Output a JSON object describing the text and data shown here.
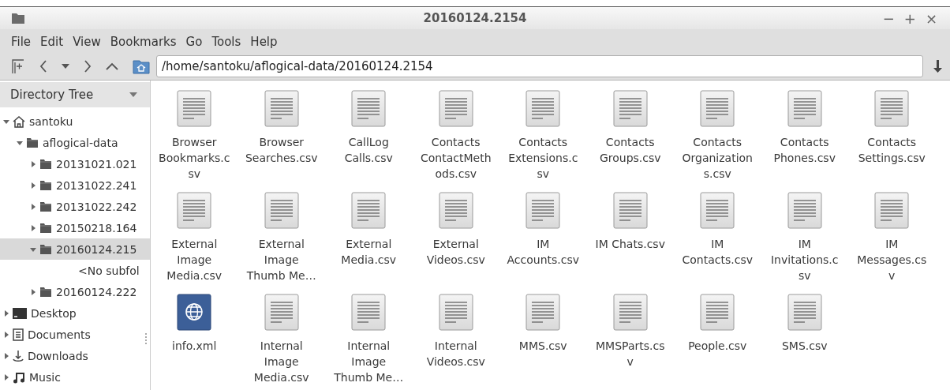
{
  "window": {
    "title": "20160124.2154",
    "controls": [
      "−",
      "+",
      "×"
    ]
  },
  "menu": [
    "File",
    "Edit",
    "View",
    "Bookmarks",
    "Go",
    "Tools",
    "Help"
  ],
  "location": {
    "value": "/home/santoku/aflogical-data/20160124.2154"
  },
  "sidebar": {
    "title": "Directory Tree",
    "items": [
      {
        "label": "santoku",
        "kind": "home",
        "expanded": true,
        "selected": false,
        "children": [
          {
            "label": "aflogical-data",
            "kind": "folder",
            "expanded": true,
            "selected": false,
            "children": [
              {
                "label": "20131021.021",
                "kind": "folder",
                "expanded": false,
                "selected": false
              },
              {
                "label": "20131022.241",
                "kind": "folder",
                "expanded": false,
                "selected": false
              },
              {
                "label": "20131022.242",
                "kind": "folder",
                "expanded": false,
                "selected": false
              },
              {
                "label": "20150218.164",
                "kind": "folder",
                "expanded": false,
                "selected": false
              },
              {
                "label": "20160124.215",
                "kind": "folder",
                "expanded": true,
                "selected": true,
                "children": [
                  {
                    "label": "<No subfol",
                    "kind": "empty",
                    "selected": false
                  }
                ]
              },
              {
                "label": "20160124.222",
                "kind": "folder",
                "expanded": false,
                "selected": false
              }
            ]
          }
        ]
      },
      {
        "label": "Desktop",
        "kind": "desktop",
        "expanded": false,
        "selected": false
      },
      {
        "label": "Documents",
        "kind": "documents",
        "expanded": false,
        "selected": false
      },
      {
        "label": "Downloads",
        "kind": "downloads",
        "expanded": false,
        "selected": false
      },
      {
        "label": "Music",
        "kind": "music",
        "expanded": false,
        "selected": false
      }
    ]
  },
  "files": [
    {
      "kind": "text",
      "lines": [
        "Browser",
        "Bookmarks.c",
        "sv"
      ]
    },
    {
      "kind": "text",
      "lines": [
        "Browser",
        "Searches.csv"
      ]
    },
    {
      "kind": "text",
      "lines": [
        "CallLog",
        "Calls.csv"
      ]
    },
    {
      "kind": "text",
      "lines": [
        "Contacts",
        "ContactMeth",
        "ods.csv"
      ]
    },
    {
      "kind": "text",
      "lines": [
        "Contacts",
        "Extensions.c",
        "sv"
      ]
    },
    {
      "kind": "text",
      "lines": [
        "Contacts",
        "Groups.csv"
      ]
    },
    {
      "kind": "text",
      "lines": [
        "Contacts",
        "Organization",
        "s.csv"
      ]
    },
    {
      "kind": "text",
      "lines": [
        "Contacts",
        "Phones.csv"
      ]
    },
    {
      "kind": "text",
      "lines": [
        "Contacts",
        "Settings.csv"
      ]
    },
    {
      "kind": "text",
      "lines": [
        "External",
        "Image",
        "Media.csv"
      ]
    },
    {
      "kind": "text",
      "lines": [
        "External",
        "Image",
        "Thumb Me…"
      ]
    },
    {
      "kind": "text",
      "lines": [
        "External",
        "Media.csv"
      ]
    },
    {
      "kind": "text",
      "lines": [
        "External",
        "Videos.csv"
      ]
    },
    {
      "kind": "text",
      "lines": [
        "IM",
        "Accounts.csv"
      ]
    },
    {
      "kind": "text",
      "lines": [
        "IM Chats.csv"
      ]
    },
    {
      "kind": "text",
      "lines": [
        "IM",
        "Contacts.csv"
      ]
    },
    {
      "kind": "text",
      "lines": [
        "IM",
        "Invitations.c",
        "sv"
      ]
    },
    {
      "kind": "text",
      "lines": [
        "IM",
        "Messages.cs",
        "v"
      ]
    },
    {
      "kind": "web",
      "lines": [
        "info.xml"
      ]
    },
    {
      "kind": "text",
      "lines": [
        "Internal",
        "Image",
        "Media.csv"
      ]
    },
    {
      "kind": "text",
      "lines": [
        "Internal",
        "Image",
        "Thumb Me…"
      ]
    },
    {
      "kind": "text",
      "lines": [
        "Internal",
        "Videos.csv"
      ]
    },
    {
      "kind": "text",
      "lines": [
        "MMS.csv"
      ]
    },
    {
      "kind": "text",
      "lines": [
        "MMSParts.cs",
        "v"
      ]
    },
    {
      "kind": "text",
      "lines": [
        "People.csv"
      ]
    },
    {
      "kind": "text",
      "lines": [
        "SMS.csv"
      ]
    }
  ]
}
